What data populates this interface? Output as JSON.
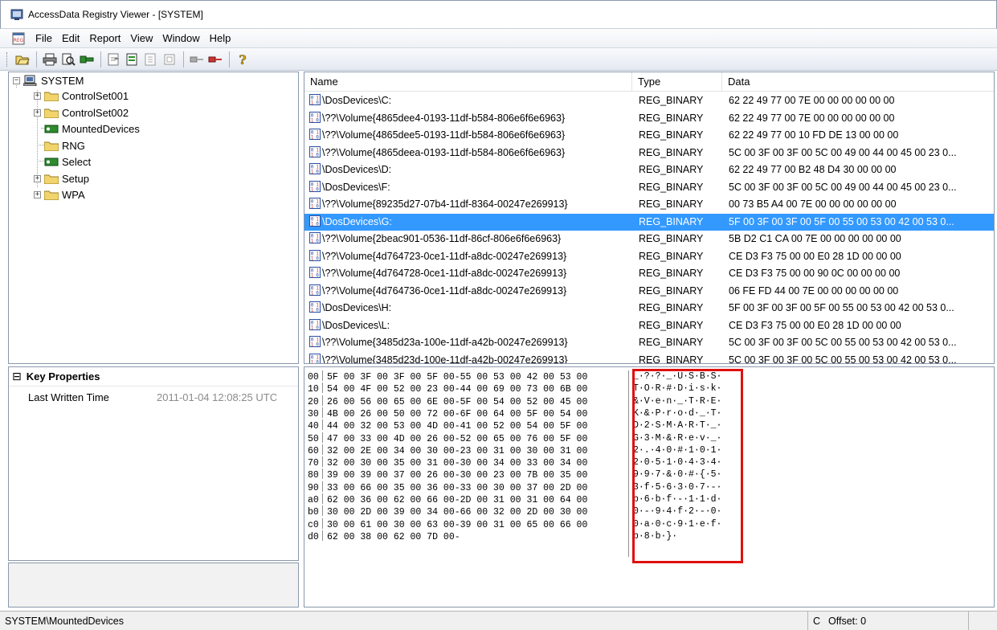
{
  "window": {
    "title": "AccessData Registry Viewer - [SYSTEM]"
  },
  "menu": [
    "File",
    "Edit",
    "Report",
    "View",
    "Window",
    "Help"
  ],
  "toolbar": {
    "icons": [
      "open-folder-icon",
      "print-icon",
      "print-preview-icon",
      "key-export-icon",
      "report-add-icon",
      "report-edit-icon",
      "report-view-icon",
      "report-icon",
      "key-left-icon",
      "key-right-icon",
      "help-icon"
    ]
  },
  "tree": {
    "root": "SYSTEM",
    "items": [
      {
        "label": "ControlSet001",
        "type": "folder",
        "expandable": true
      },
      {
        "label": "ControlSet002",
        "type": "folder",
        "expandable": true
      },
      {
        "label": "MountedDevices",
        "type": "key",
        "expandable": false
      },
      {
        "label": "RNG",
        "type": "folder",
        "expandable": false
      },
      {
        "label": "Select",
        "type": "key",
        "expandable": false
      },
      {
        "label": "Setup",
        "type": "folder",
        "expandable": true
      },
      {
        "label": "WPA",
        "type": "folder",
        "expandable": true
      }
    ]
  },
  "list": {
    "columns": [
      "Name",
      "Type",
      "Data"
    ],
    "rows": [
      {
        "name": "\\DosDevices\\C:",
        "type": "REG_BINARY",
        "data": "62 22 49 77 00 7E 00 00 00 00 00 00"
      },
      {
        "name": "\\??\\Volume{4865dee4-0193-11df-b584-806e6f6e6963}",
        "type": "REG_BINARY",
        "data": "62 22 49 77 00 7E 00 00 00 00 00 00"
      },
      {
        "name": "\\??\\Volume{4865dee5-0193-11df-b584-806e6f6e6963}",
        "type": "REG_BINARY",
        "data": "62 22 49 77 00 10 FD DE 13 00 00 00"
      },
      {
        "name": "\\??\\Volume{4865deea-0193-11df-b584-806e6f6e6963}",
        "type": "REG_BINARY",
        "data": "5C 00 3F 00 3F 00 5C 00 49 00 44 00 45 00 23 0..."
      },
      {
        "name": "\\DosDevices\\D:",
        "type": "REG_BINARY",
        "data": "62 22 49 77 00 B2 48 D4 30 00 00 00"
      },
      {
        "name": "\\DosDevices\\F:",
        "type": "REG_BINARY",
        "data": "5C 00 3F 00 3F 00 5C 00 49 00 44 00 45 00 23 0..."
      },
      {
        "name": "\\??\\Volume{89235d27-07b4-11df-8364-00247e269913}",
        "type": "REG_BINARY",
        "data": "00 73 B5 A4 00 7E 00 00 00 00 00 00"
      },
      {
        "name": "\\DosDevices\\G:",
        "type": "REG_BINARY",
        "data": "5F 00 3F 00 3F 00 5F 00 55 00 53 00 42 00 53 0...",
        "selected": true
      },
      {
        "name": "\\??\\Volume{2beac901-0536-11df-86cf-806e6f6e6963}",
        "type": "REG_BINARY",
        "data": "5B D2 C1 CA 00 7E 00 00 00 00 00 00"
      },
      {
        "name": "\\??\\Volume{4d764723-0ce1-11df-a8dc-00247e269913}",
        "type": "REG_BINARY",
        "data": "CE D3 F3 75 00 00 E0 28 1D 00 00 00"
      },
      {
        "name": "\\??\\Volume{4d764728-0ce1-11df-a8dc-00247e269913}",
        "type": "REG_BINARY",
        "data": "CE D3 F3 75 00 00 90 0C 00 00 00 00"
      },
      {
        "name": "\\??\\Volume{4d764736-0ce1-11df-a8dc-00247e269913}",
        "type": "REG_BINARY",
        "data": "06 FE FD 44 00 7E 00 00 00 00 00 00"
      },
      {
        "name": "\\DosDevices\\H:",
        "type": "REG_BINARY",
        "data": "5F 00 3F 00 3F 00 5F 00 55 00 53 00 42 00 53 0..."
      },
      {
        "name": "\\DosDevices\\L:",
        "type": "REG_BINARY",
        "data": "CE D3 F3 75 00 00 E0 28 1D 00 00 00"
      },
      {
        "name": "\\??\\Volume{3485d23a-100e-11df-a42b-00247e269913}",
        "type": "REG_BINARY",
        "data": "5C 00 3F 00 3F 00 5C 00 55 00 53 00 42 00 53 0..."
      },
      {
        "name": "\\??\\Volume{3485d23d-100e-11df-a42b-00247e269913}",
        "type": "REG_BINARY",
        "data": "5C 00 3F 00 3F 00 5C 00 55 00 53 00 42 00 53 0..."
      }
    ]
  },
  "properties": {
    "header": "Key Properties",
    "collapse_glyph": "⊟",
    "rows": [
      {
        "label": "Last Written Time",
        "value": "2011-01-04 12:08:25 UTC"
      }
    ]
  },
  "hex": {
    "lines": [
      {
        "off": "00",
        "bytes": "5F 00 3F 00 3F 00 5F 00-55 00 53 00 42 00 53 00",
        "ascii": "_·?·?·_·U·S·B·S·"
      },
      {
        "off": "10",
        "bytes": "54 00 4F 00 52 00 23 00-44 00 69 00 73 00 6B 00",
        "ascii": "T·O·R·#·D·i·s·k·"
      },
      {
        "off": "20",
        "bytes": "26 00 56 00 65 00 6E 00-5F 00 54 00 52 00 45 00",
        "ascii": "&·V·e·n·_·T·R·E·"
      },
      {
        "off": "30",
        "bytes": "4B 00 26 00 50 00 72 00-6F 00 64 00 5F 00 54 00",
        "ascii": "K·&·P·r·o·d·_·T·"
      },
      {
        "off": "40",
        "bytes": "44 00 32 00 53 00 4D 00-41 00 52 00 54 00 5F 00",
        "ascii": "D·2·S·M·A·R·T·_·"
      },
      {
        "off": "50",
        "bytes": "47 00 33 00 4D 00 26 00-52 00 65 00 76 00 5F 00",
        "ascii": "G·3·M·&·R·e·v·_·"
      },
      {
        "off": "60",
        "bytes": "32 00 2E 00 34 00 30 00-23 00 31 00 30 00 31 00",
        "ascii": "2·.·4·0·#·1·0·1·"
      },
      {
        "off": "70",
        "bytes": "32 00 30 00 35 00 31 00-30 00 34 00 33 00 34 00",
        "ascii": "2·0·5·1·0·4·3·4·"
      },
      {
        "off": "80",
        "bytes": "39 00 39 00 37 00 26 00-30 00 23 00 7B 00 35 00",
        "ascii": "9·9·7·&·0·#·{·5·"
      },
      {
        "off": "90",
        "bytes": "33 00 66 00 35 00 36 00-33 00 30 00 37 00 2D 00",
        "ascii": "3·f·5·6·3·0·7·-·"
      },
      {
        "off": "a0",
        "bytes": "62 00 36 00 62 00 66 00-2D 00 31 00 31 00 64 00",
        "ascii": "b·6·b·f·-·1·1·d·"
      },
      {
        "off": "b0",
        "bytes": "30 00 2D 00 39 00 34 00-66 00 32 00 2D 00 30 00",
        "ascii": "0·-·9·4·f·2·-·0·"
      },
      {
        "off": "c0",
        "bytes": "30 00 61 00 30 00 63 00-39 00 31 00 65 00 66 00",
        "ascii": "0·a·0·c·9·1·e·f·"
      },
      {
        "off": "d0",
        "bytes": "62 00 38 00 62 00 7D 00-",
        "ascii": "b·8·b·}·"
      }
    ]
  },
  "status": {
    "path": "SYSTEM\\MountedDevices",
    "c": "C",
    "offset": "Offset: 0"
  },
  "colors": {
    "selection": "#3399ff",
    "highlight_box": "#e01010",
    "folder": "#f2d46c"
  }
}
